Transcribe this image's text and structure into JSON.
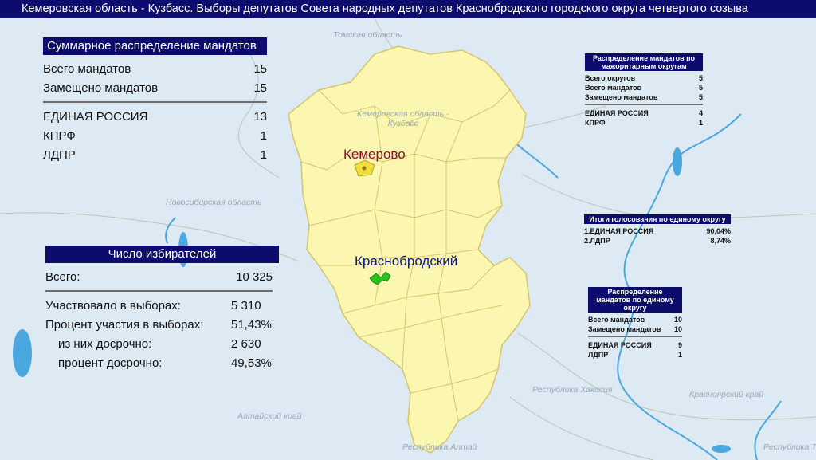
{
  "title": "Кемеровская область - Кузбасс. Выборы депутатов Совета народных депутатов Краснобродского городского округа четвертого созыва",
  "map": {
    "labels": {
      "tomsk": "Томская область",
      "kemerovo_region": "Кемеровская область -\nКузбасс",
      "novosibirsk": "Новосибирская область",
      "altai_krai": "Алтайский край",
      "altai_rep": "Республика Алтай",
      "khakassia": "Республика Хакасия",
      "krasnoyarsk": "Красноярский край",
      "tyva": "Республика Тыва"
    },
    "cities": {
      "kemerovo": "Кемерово",
      "krasnobrodsky": "Краснобродский"
    },
    "colors": {
      "water": "#dde9f3",
      "region_fill": "#fbf6b0",
      "highlight": "#27c21c",
      "header_bg": "#0c0c6e"
    }
  },
  "mandates_summary": {
    "header": "Суммарное распределение мандатов",
    "rows": [
      {
        "label": "Всего мандатов",
        "value": "15"
      },
      {
        "label": "Замещено мандатов",
        "value": "15"
      }
    ],
    "parties": [
      {
        "label": "ЕДИНАЯ РОССИЯ",
        "value": "13"
      },
      {
        "label": "КПРФ",
        "value": "1"
      },
      {
        "label": "ЛДПР",
        "value": "1"
      }
    ]
  },
  "voters": {
    "header": "Число избирателей",
    "total_label": "Всего:",
    "total_value": "10 325",
    "rows": [
      {
        "label": "Участвовало в выборах:",
        "value": "5 310"
      },
      {
        "label": "Процент участия в выборах:",
        "value": "51,43%"
      },
      {
        "label": "из них досрочно:",
        "value": "2 630"
      },
      {
        "label": "процент досрочно:",
        "value": "49,53%"
      }
    ]
  },
  "majoritarian": {
    "header": "Распределение мандатов по мажоритарным округам",
    "rows": [
      {
        "label": "Всего округов",
        "value": "5"
      },
      {
        "label": "Всего мандатов",
        "value": "5"
      },
      {
        "label": "Замещено мандатов",
        "value": "5"
      }
    ],
    "parties": [
      {
        "label": "ЕДИНАЯ РОССИЯ",
        "value": "4"
      },
      {
        "label": "КПРФ",
        "value": "1"
      }
    ]
  },
  "single_district_results": {
    "header": "Итоги голосования по единому округу",
    "rows": [
      {
        "label": "1.ЕДИНАЯ РОССИЯ",
        "value": "90,04%"
      },
      {
        "label": "2.ЛДПР",
        "value": "8,74%"
      }
    ]
  },
  "single_district_mandates": {
    "header": "Распределение мандатов по единому округу",
    "rows": [
      {
        "label": "Всего мандатов",
        "value": "10"
      },
      {
        "label": "Замещено мандатов",
        "value": "10"
      }
    ],
    "parties": [
      {
        "label": "ЕДИНАЯ РОССИЯ",
        "value": "9"
      },
      {
        "label": "ЛДПР",
        "value": "1"
      }
    ]
  }
}
